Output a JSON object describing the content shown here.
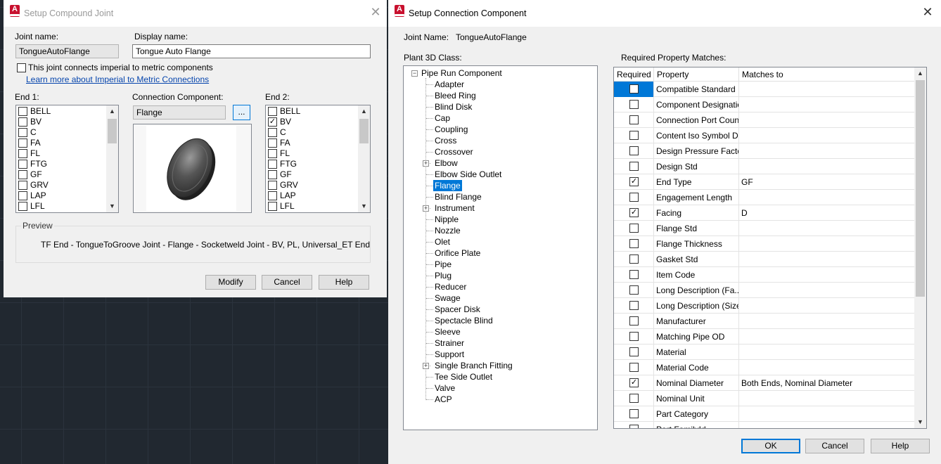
{
  "compound": {
    "title": "Setup Compound Joint",
    "joint_name_label": "Joint name:",
    "joint_name_value": "TongueAutoFlange",
    "display_name_label": "Display name:",
    "display_name_value": "Tongue Auto Flange",
    "imperial_check_label": "This joint connects imperial to metric components",
    "imperial_link": "Learn more about Imperial to Metric Connections",
    "end1_label": "End 1:",
    "end1_items": [
      {
        "label": "BELL",
        "checked": false
      },
      {
        "label": "BV",
        "checked": false
      },
      {
        "label": "C",
        "checked": false
      },
      {
        "label": "FA",
        "checked": false
      },
      {
        "label": "FL",
        "checked": false
      },
      {
        "label": "FTG",
        "checked": false
      },
      {
        "label": "GF",
        "checked": false
      },
      {
        "label": "GRV",
        "checked": false
      },
      {
        "label": "LAP",
        "checked": false
      },
      {
        "label": "LFL",
        "checked": false
      }
    ],
    "connection_label": "Connection Component:",
    "connection_value": "Flange",
    "browse_label": "...",
    "end2_label": "End 2:",
    "end2_items": [
      {
        "label": "BELL",
        "checked": false
      },
      {
        "label": "BV",
        "checked": true
      },
      {
        "label": "C",
        "checked": false
      },
      {
        "label": "FA",
        "checked": false
      },
      {
        "label": "FL",
        "checked": false
      },
      {
        "label": "FTG",
        "checked": false
      },
      {
        "label": "GF",
        "checked": false
      },
      {
        "label": "GRV",
        "checked": false
      },
      {
        "label": "LAP",
        "checked": false
      },
      {
        "label": "LFL",
        "checked": false
      }
    ],
    "preview_label": "Preview",
    "preview_text": "TF End - TongueToGroove Joint - Flange - Socketweld Joint - BV, PL, Universal_ET End",
    "buttons": {
      "modify": "Modify",
      "cancel": "Cancel",
      "help": "Help"
    }
  },
  "connection": {
    "title": "Setup Connection Component",
    "joint_name_label": "Joint Name:",
    "joint_name_value": "TongueAutoFlange",
    "class_label": "Plant 3D Class:",
    "tree_root": "Pipe Run Component",
    "tree_items": [
      {
        "label": "Adapter",
        "expandable": false,
        "selected": false
      },
      {
        "label": "Bleed Ring",
        "expandable": false,
        "selected": false
      },
      {
        "label": "Blind Disk",
        "expandable": false,
        "selected": false
      },
      {
        "label": "Cap",
        "expandable": false,
        "selected": false
      },
      {
        "label": "Coupling",
        "expandable": false,
        "selected": false
      },
      {
        "label": "Cross",
        "expandable": false,
        "selected": false
      },
      {
        "label": "Crossover",
        "expandable": false,
        "selected": false
      },
      {
        "label": "Elbow",
        "expandable": true,
        "selected": false
      },
      {
        "label": "Elbow Side Outlet",
        "expandable": false,
        "selected": false
      },
      {
        "label": "Flange",
        "expandable": false,
        "selected": true
      },
      {
        "label": "Blind Flange",
        "expandable": false,
        "selected": false
      },
      {
        "label": "Instrument",
        "expandable": true,
        "selected": false
      },
      {
        "label": "Nipple",
        "expandable": false,
        "selected": false
      },
      {
        "label": "Nozzle",
        "expandable": false,
        "selected": false
      },
      {
        "label": "Olet",
        "expandable": false,
        "selected": false
      },
      {
        "label": "Orifice Plate",
        "expandable": false,
        "selected": false
      },
      {
        "label": "Pipe",
        "expandable": false,
        "selected": false
      },
      {
        "label": "Plug",
        "expandable": false,
        "selected": false
      },
      {
        "label": "Reducer",
        "expandable": false,
        "selected": false
      },
      {
        "label": "Swage",
        "expandable": false,
        "selected": false
      },
      {
        "label": "Spacer Disk",
        "expandable": false,
        "selected": false
      },
      {
        "label": "Spectacle Blind",
        "expandable": false,
        "selected": false
      },
      {
        "label": "Sleeve",
        "expandable": false,
        "selected": false
      },
      {
        "label": "Strainer",
        "expandable": false,
        "selected": false
      },
      {
        "label": "Support",
        "expandable": false,
        "selected": false
      },
      {
        "label": "Single Branch Fitting",
        "expandable": true,
        "selected": false
      },
      {
        "label": "Tee Side Outlet",
        "expandable": false,
        "selected": false
      },
      {
        "label": "Valve",
        "expandable": false,
        "selected": false
      },
      {
        "label": "ACP",
        "expandable": false,
        "selected": false
      }
    ],
    "matches_label": "Required Property Matches:",
    "columns": {
      "required": "Required",
      "property": "Property",
      "matches": "Matches to"
    },
    "rows": [
      {
        "property": "Compatible Standard",
        "required": false,
        "matches": ""
      },
      {
        "property": "Component Designation",
        "required": false,
        "matches": ""
      },
      {
        "property": "Connection Port Count",
        "required": false,
        "matches": ""
      },
      {
        "property": "Content Iso Symbol D...",
        "required": false,
        "matches": ""
      },
      {
        "property": "Design Pressure Factor",
        "required": false,
        "matches": ""
      },
      {
        "property": "Design Std",
        "required": false,
        "matches": ""
      },
      {
        "property": "End Type",
        "required": true,
        "matches": "GF"
      },
      {
        "property": "Engagement Length",
        "required": false,
        "matches": ""
      },
      {
        "property": "Facing",
        "required": true,
        "matches": "D"
      },
      {
        "property": "Flange Std",
        "required": false,
        "matches": ""
      },
      {
        "property": "Flange Thickness",
        "required": false,
        "matches": ""
      },
      {
        "property": "Gasket Std",
        "required": false,
        "matches": ""
      },
      {
        "property": "Item Code",
        "required": false,
        "matches": ""
      },
      {
        "property": "Long Description (Fa...",
        "required": false,
        "matches": ""
      },
      {
        "property": "Long Description (Size)",
        "required": false,
        "matches": ""
      },
      {
        "property": "Manufacturer",
        "required": false,
        "matches": ""
      },
      {
        "property": "Matching Pipe OD",
        "required": false,
        "matches": ""
      },
      {
        "property": "Material",
        "required": false,
        "matches": ""
      },
      {
        "property": "Material Code",
        "required": false,
        "matches": ""
      },
      {
        "property": "Nominal Diameter",
        "required": true,
        "matches": "Both Ends, Nominal Diameter"
      },
      {
        "property": "Nominal Unit",
        "required": false,
        "matches": ""
      },
      {
        "property": "Part Category",
        "required": false,
        "matches": ""
      },
      {
        "property": "Part FamilyId",
        "required": false,
        "matches": ""
      }
    ],
    "buttons": {
      "ok": "OK",
      "cancel": "Cancel",
      "help": "Help"
    }
  },
  "colors": {
    "accent": "#0078d7",
    "brand_red": "#c8102e",
    "canvas": "#212830"
  },
  "icons": {
    "app": "autocad-plant3d-icon",
    "close": "close-icon",
    "check": "checkmark-icon"
  }
}
